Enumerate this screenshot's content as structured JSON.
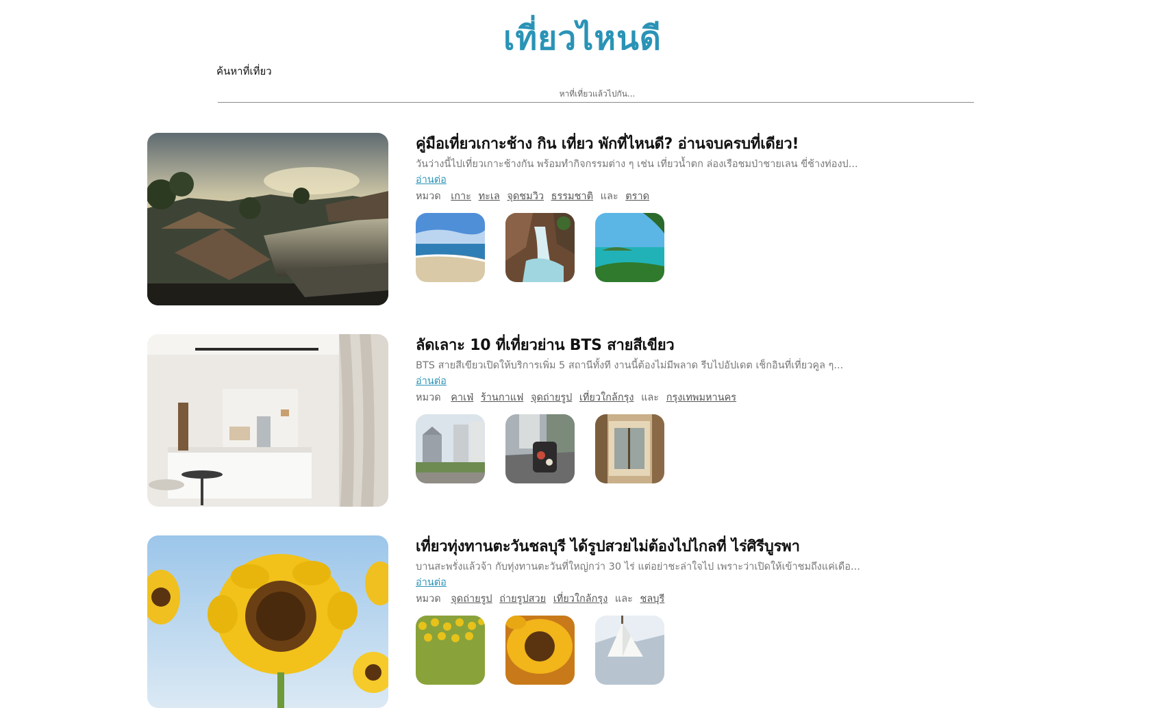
{
  "site": {
    "title": "เที่ยวไหนดี"
  },
  "search": {
    "label": "ค้นหาที่เที่ยว",
    "placeholder": "หาที่เที่ยวแล้วไปกัน..."
  },
  "articles": [
    {
      "title": "คู่มือเที่ยวเกาะช้าง กิน เที่ยว พักที่ไหนดี? อ่านจบครบที่เดียว!",
      "excerpt": "วันว่างนี้ไปเที่ยวเกาะช้างกัน พร้อมทำกิจกรรมต่าง ๆ เช่น เที่ยวน้ำตก ล่องเรือชมป่าชายเลน ขี่ช้างท่องป...",
      "read_more": "อ่านต่อ",
      "category_prefix": "หมวด",
      "categories": [
        "เกาะ",
        "ทะเล",
        "จุดชมวิว",
        "ธรรมชาติ"
      ],
      "category_last": "ตราด",
      "and_text": "และ"
    },
    {
      "title": "ลัดเลาะ 10 ที่เที่ยวย่าน BTS สายสีเขียว",
      "excerpt": "BTS สายสีเขียวเปิดให้บริการเพิ่ม 5 สถานีทั้งที งานนี้ต้องไม่มีพลาด รีบไปอัปเดต เช็กอินที่เที่ยวคูล ๆ...",
      "read_more": "อ่านต่อ",
      "category_prefix": "หมวด",
      "categories": [
        "คาเฟ่",
        "ร้านกาแฟ",
        "จุดถ่ายรูป",
        "เที่ยวใกล้กรุง"
      ],
      "category_last": "กรุงเทพมหานคร",
      "and_text": "และ"
    },
    {
      "title": "เที่ยวทุ่งทานตะวันชลบุรี ได้รูปสวยไม่ต้องไปไกลที่ ไร่ศิรีบูรพา",
      "excerpt": "บานสะพรั่งแล้วจ้า กับทุ่งทานตะวันที่ใหญ่กว่า 30 ไร่ แต่อย่าชะล่าใจไป เพราะว่าเปิดให้เข้าชมถึงแค่เดือ...",
      "read_more": "อ่านต่อ",
      "category_prefix": "หมวด",
      "categories": [
        "จุดถ่ายรูป",
        "ถ่ายรูปสวย",
        "เที่ยวใกล้กรุง"
      ],
      "category_last": "ชลบุรี",
      "and_text": "และ"
    }
  ],
  "colors": {
    "title": "#2a93b6",
    "link": "#2a93b6",
    "muted": "#777777"
  }
}
